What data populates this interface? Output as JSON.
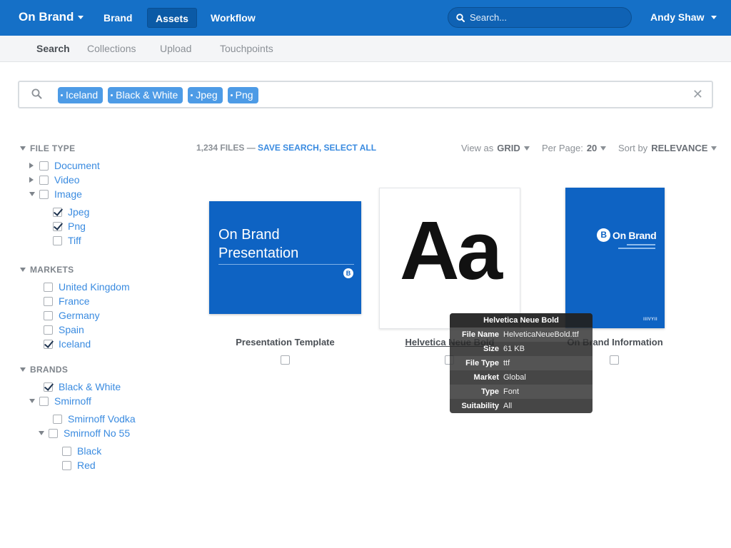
{
  "app": {
    "brand": "On Brand",
    "nav": [
      "Brand",
      "Assets",
      "Workflow"
    ],
    "active_nav": "Assets",
    "search_placeholder": "Search...",
    "user": "Andy Shaw"
  },
  "subnav": {
    "items": [
      "Search",
      "Collections",
      "Upload",
      "Touchpoints"
    ],
    "active": "Search"
  },
  "filter_tags": [
    "Iceland",
    "Black & White",
    "Jpeg",
    "Png"
  ],
  "sidebar": {
    "file_type": {
      "title": "FILE TYPE",
      "items": [
        {
          "label": "Document",
          "checked": false
        },
        {
          "label": "Video",
          "checked": false
        },
        {
          "label": "Image",
          "checked": false
        },
        {
          "label": "Jpeg",
          "checked": true
        },
        {
          "label": "Png",
          "checked": true
        },
        {
          "label": "Tiff",
          "checked": false
        }
      ]
    },
    "markets": {
      "title": "MARKETS",
      "items": [
        {
          "label": "United Kingdom",
          "checked": false
        },
        {
          "label": "France",
          "checked": false
        },
        {
          "label": "Germany",
          "checked": false
        },
        {
          "label": "Spain",
          "checked": false
        },
        {
          "label": "Iceland",
          "checked": true
        }
      ]
    },
    "brands": {
      "title": "BRANDS",
      "items": [
        {
          "label": "Black & White",
          "checked": true
        },
        {
          "label": "Smirnoff",
          "checked": false
        },
        {
          "label": "Smirnoff Vodka",
          "checked": false
        },
        {
          "label": "Smirnoff No 55",
          "checked": false
        },
        {
          "label": "Black",
          "checked": false
        },
        {
          "label": "Red",
          "checked": false
        }
      ]
    }
  },
  "results": {
    "count_text": "1,234 FILES —",
    "save_search": "SAVE SEARCH,",
    "select_all": "SELECT ALL",
    "view_label": "View as",
    "view_value": "GRID",
    "per_page_label": "Per Page:",
    "per_page_value": "20",
    "sort_label": "Sort by",
    "sort_value": "RELEVANCE"
  },
  "assets": [
    {
      "title": "Presentation Template",
      "thumb_line1": "On Brand",
      "thumb_line2": "Presentation",
      "badge": "B"
    },
    {
      "title": "Helvetica Neue Bold",
      "glyph": "Aa"
    },
    {
      "title": "On Brand Information",
      "logo_text": "On Brand",
      "badge": "B",
      "footer": "IIIVYII"
    }
  ],
  "tooltip": {
    "title": "Helvetica Neue Bold",
    "rows": [
      {
        "key": "File Name",
        "value": "HelveticaNeueBold.ttf"
      },
      {
        "key": "Size",
        "value": "61 KB"
      },
      {
        "key": "File Type",
        "value": "ttf"
      },
      {
        "key": "Market",
        "value": "Global"
      },
      {
        "key": "Type",
        "value": "Font"
      },
      {
        "key": "Suitability",
        "value": "All"
      }
    ]
  },
  "colors": {
    "topbar": "#1570c7",
    "accent": "#3a8be0",
    "tag": "#4d9be6",
    "thumb_blue": "#0e63c3"
  }
}
